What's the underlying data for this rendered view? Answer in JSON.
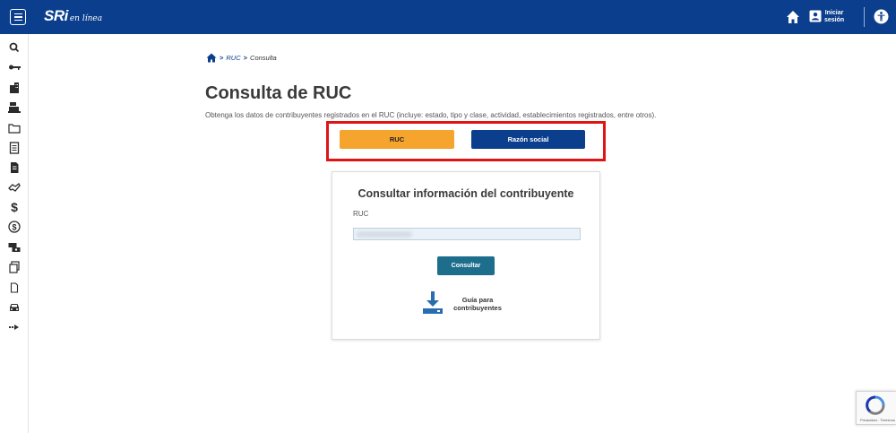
{
  "header": {
    "logo_main": "SRi",
    "logo_sub": "en línea",
    "login_label_line1": "Iniciar",
    "login_label_line2": "sesión",
    "colors": {
      "brand": "#0b3e8c"
    },
    "icons": [
      "menu-icon",
      "home-icon",
      "user-card-icon",
      "accessibility-icon"
    ]
  },
  "sidebar": {
    "icons": [
      "search-icon",
      "key-icon",
      "buildings-icon",
      "cash-register-icon",
      "folder-icon",
      "document-list-icon",
      "document-icon",
      "handshake-icon",
      "dollar-icon",
      "dollar-circle-icon",
      "money-exchange-icon",
      "documents-icon",
      "small-document-icon",
      "car-icon",
      "arrow-right-icon"
    ]
  },
  "breadcrumb": {
    "items": [
      "RUC",
      "Consulta"
    ]
  },
  "page": {
    "title": "Consulta de RUC",
    "description": "Obtenga los datos de contribuyentes registrados en el RUC (incluye: estado, tipo y clase, actividad, establecimientos registrados, entre otros)."
  },
  "tabs": {
    "ruc_label": "RUC",
    "razon_label": "Razón social",
    "colors": {
      "active": "#f5a42e",
      "inactive": "#0b3e8c",
      "highlight_border": "#e01414"
    }
  },
  "card": {
    "title": "Consultar información del contribuyente",
    "field_label": "RUC",
    "field_value": "",
    "submit_label": "Consultar",
    "guide_line1": "Guía para",
    "guide_line2": "contribuyentes"
  },
  "recaptcha": {
    "footer": "Privacidad - Términos"
  }
}
